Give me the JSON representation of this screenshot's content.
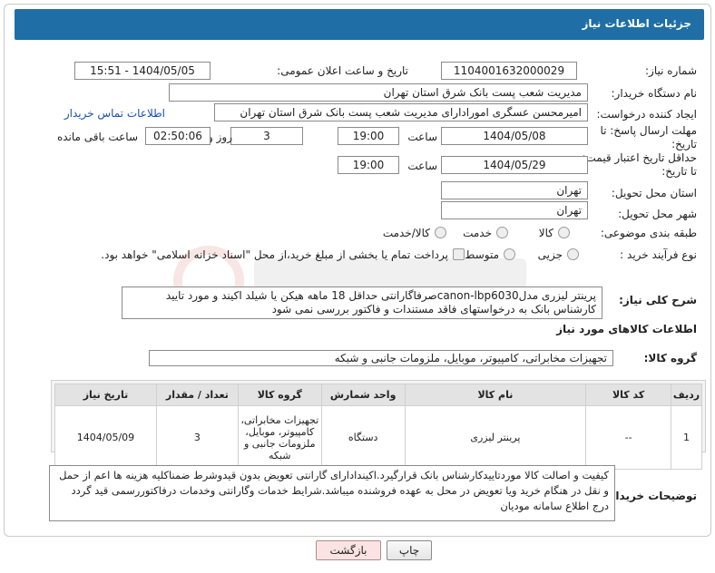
{
  "header": {
    "title": "جزئیات اطلاعات نیاز"
  },
  "fields": {
    "need_number_label": "شماره نیاز:",
    "need_number": "1104001632000029",
    "announce_label": "تاریخ و ساعت اعلان عمومی:",
    "announce_value": "1404/05/05 - 15:51",
    "buyer_org_label": "نام دستگاه خریدار:",
    "buyer_org": "مدیریت شعب پست بانک شرق استان تهران",
    "requester_label": "ایجاد کننده درخواست:",
    "requester": "امیرمحسن عسگری امورادارای مدیریت شعب پست بانک شرق استان تهران",
    "contact_link": "اطلاعات تماس خریدار",
    "reply_deadline_label_1": "مهلت ارسال پاسخ: تا",
    "reply_deadline_label_2": "تاریخ:",
    "reply_date": "1404/05/08",
    "time_label": "ساعت",
    "reply_time": "19:00",
    "days_value": "3",
    "days_label": "روز و",
    "remaining_time": "02:50:06",
    "remaining_label": "ساعت باقی مانده",
    "price_validity_label_1": "حداقل تاریخ اعتبار قیمت:",
    "price_validity_label_2": "تا تاریخ:",
    "price_date": "1404/05/29",
    "price_time": "19:00",
    "province_label": "استان محل تحویل:",
    "province": "تهران",
    "city_label": "شهر محل تحویل:",
    "city": "تهران",
    "category_label": "طبقه بندی موضوعی:",
    "category_options": [
      "کالا",
      "خدمت",
      "کالا/خدمت"
    ],
    "process_label": "نوع فرآیند خرید :",
    "process_options": [
      "جزیی",
      "متوسط"
    ],
    "payment_note": "پرداخت تمام یا بخشی از مبلغ خرید،از محل \"اسناد خزانه اسلامی\" خواهد بود."
  },
  "general_desc": {
    "label": "شرح کلی نیاز:",
    "text": "پرینتر لیزری مدلcanon-lbp6030صرفاگارانتی حداقل 18 ماهه هیکن یا شیلد اکیند و مورد تایید کارشناس بانک به درخواستهای فاقد مستندات و فاکتور بررسی نمی شود"
  },
  "goods_info": {
    "title": "اطلاعات کالاهای مورد نیاز",
    "group_label": "گروه کالا:",
    "group_value": "تجهیزات مخابراتی، کامپیوتر، موبایل، ملزومات جانبی و شبکه"
  },
  "table": {
    "headers": [
      "ردیف",
      "کد کالا",
      "نام کالا",
      "واحد شمارش",
      "گروه کالا",
      "تعداد / مقدار",
      "تاریخ نیاز"
    ],
    "rows": [
      [
        "1",
        "--",
        "پرینتر لیزری",
        "دستگاه",
        "تجهیزات مخابراتی، کامپیوتر، موبایل، ملزومات جانبی و شبکه",
        "3",
        "1404/05/09"
      ]
    ]
  },
  "buyer_notes": {
    "label": "توضیحات خریدار:",
    "text": "کیفیت و اصالت کالا موردتاییدکارشناس بانک قرارگیرد.اکیندادارای گارانتی تعویض بدون قیدوشرط ضمناکلیه هزینه ها اعم از حمل و نقل در هنگام خرید ویا تعویض در محل به عهده فروشنده میباشد.شرایط خدمات وگارانتی وخدمات درفاکتوررسمی قید گردد درج اطلاع سامانه مودیان"
  },
  "buttons": {
    "print": "چاپ",
    "back": "بازگشت"
  },
  "colors": {
    "header_bg": "#1f6ea6",
    "link": "#1a4fb0",
    "back_btn": "#fbe3e3"
  }
}
